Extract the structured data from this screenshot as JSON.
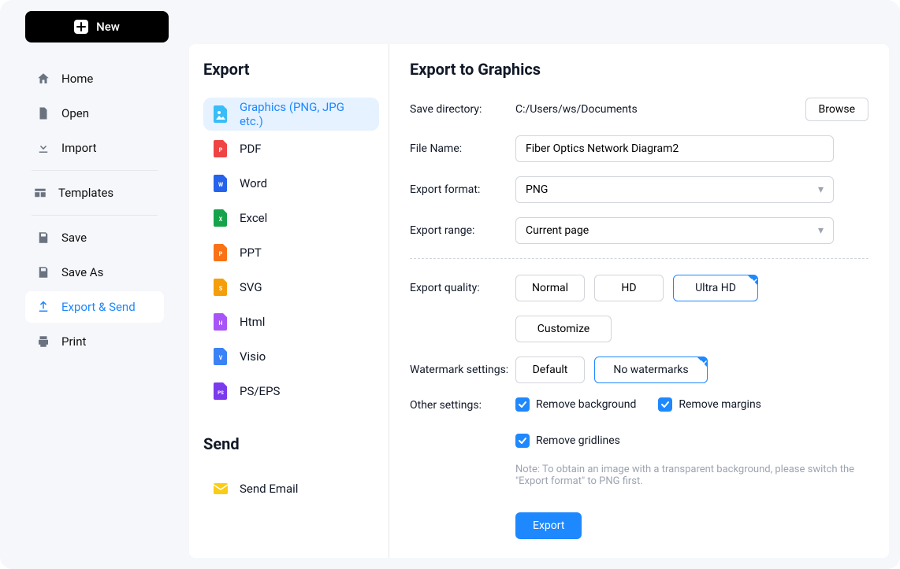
{
  "buttons": {
    "new": "New",
    "browse": "Browse",
    "customize": "Customize",
    "export": "Export"
  },
  "sidebar": {
    "items": [
      {
        "icon": "home-icon",
        "label": "Home"
      },
      {
        "icon": "file-icon",
        "label": "Open"
      },
      {
        "icon": "import-icon",
        "label": "Import"
      }
    ],
    "templates": {
      "label": "Templates"
    },
    "items2": [
      {
        "icon": "save-icon",
        "label": "Save"
      },
      {
        "icon": "saveas-icon",
        "label": "Save As"
      },
      {
        "icon": "export-icon",
        "label": "Export & Send"
      },
      {
        "icon": "print-icon",
        "label": "Print"
      }
    ],
    "active_index": 2
  },
  "export_panel": {
    "title": "Export",
    "formats": [
      {
        "label": "Graphics (PNG, JPG etc.)",
        "color": "#38bdf8",
        "selected": true
      },
      {
        "label": "PDF",
        "color": "#ef4444"
      },
      {
        "label": "Word",
        "color": "#2563eb"
      },
      {
        "label": "Excel",
        "color": "#16a34a"
      },
      {
        "label": "PPT",
        "color": "#f97316"
      },
      {
        "label": "SVG",
        "color": "#f59e0b"
      },
      {
        "label": "Html",
        "color": "#a855f7"
      },
      {
        "label": "Visio",
        "color": "#3b82f6"
      },
      {
        "label": "PS/EPS",
        "color": "#7c3aed"
      }
    ],
    "send_title": "Send",
    "send_items": [
      {
        "label": "Send Email",
        "color": "#facc15"
      }
    ]
  },
  "form": {
    "title": "Export to Graphics",
    "labels": {
      "save_dir": "Save directory:",
      "file_name": "File Name:",
      "export_format": "Export format:",
      "export_range": "Export range:",
      "export_quality": "Export quality:",
      "watermark": "Watermark settings:",
      "other": "Other settings:"
    },
    "values": {
      "save_dir": "C:/Users/ws/Documents",
      "file_name": "Fiber Optics Network Diagram2",
      "export_format": "PNG",
      "export_range": "Current page"
    },
    "quality_options": [
      "Normal",
      "HD",
      "Ultra HD"
    ],
    "quality_selected": "Ultra HD",
    "watermark_options": [
      "Default",
      "No watermarks"
    ],
    "watermark_selected": "No watermarks",
    "other_options": [
      {
        "label": "Remove background",
        "checked": true
      },
      {
        "label": "Remove margins",
        "checked": true
      },
      {
        "label": "Remove gridlines",
        "checked": true
      }
    ],
    "note": "Note: To obtain an image with a transparent background, please switch the \"Export format\" to PNG first."
  }
}
